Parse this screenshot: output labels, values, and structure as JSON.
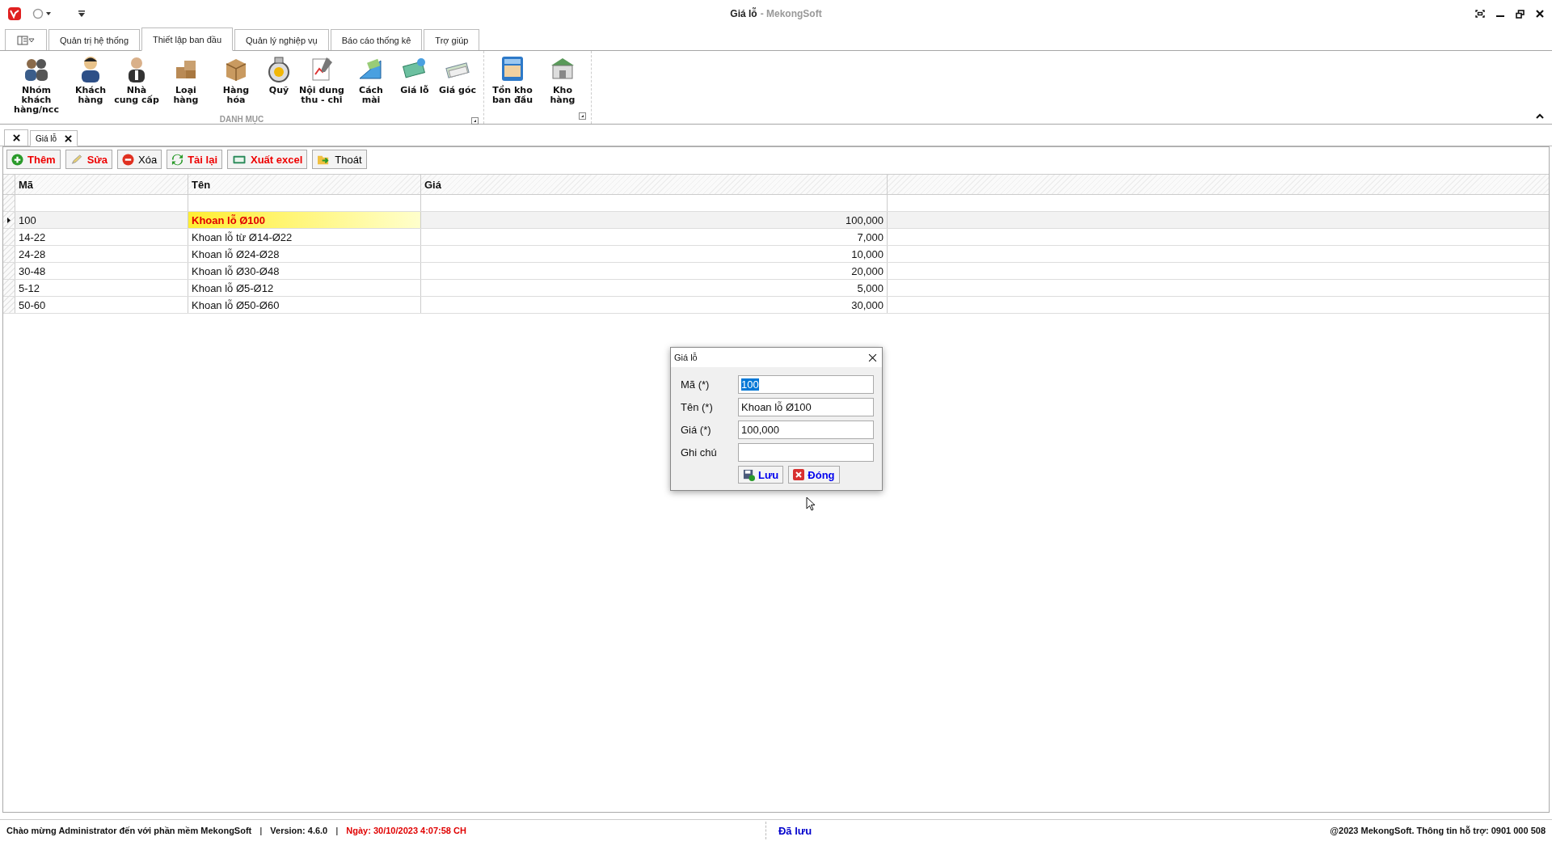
{
  "window": {
    "title": "Giá lỗ",
    "app_name": "- MekongSoft"
  },
  "ribbon_tabs": [
    {
      "label": "Quản trị hệ thống",
      "selected": false
    },
    {
      "label": "Thiết lập ban đầu",
      "selected": true
    },
    {
      "label": "Quản lý nghiệp vụ",
      "selected": false
    },
    {
      "label": "Báo cáo thống kê",
      "selected": false
    },
    {
      "label": "Trợ giúp",
      "selected": false
    }
  ],
  "ribbon_groups": [
    {
      "label": "DANH MỤC",
      "items": [
        "Nhóm khách hàng/ncc",
        "Khách hàng",
        "Nhà cung cấp",
        "Loại hàng",
        "Hàng hóa",
        "Quỹ",
        "Nội dung thu - chi",
        "Cách mài",
        "Giá lỗ",
        "Giá góc"
      ]
    },
    {
      "items": [
        "Tồn kho ban đầu",
        "Kho hàng"
      ]
    }
  ],
  "doc_tabs": [
    {
      "label": "Giá lỗ",
      "selected": true
    }
  ],
  "toolbar": [
    {
      "label": "Thêm",
      "color": "#ee0000"
    },
    {
      "label": "Sửa",
      "color": "#ee0000"
    },
    {
      "label": "Xóa",
      "color": "#000000"
    },
    {
      "label": "Tải lại",
      "color": "#ee0000"
    },
    {
      "label": "Xuất excel",
      "color": "#ee0000"
    },
    {
      "label": "Thoát",
      "color": "#000000"
    }
  ],
  "table": {
    "columns": [
      "Mã",
      "Tên",
      "Giá"
    ],
    "rows": [
      {
        "cells": [
          "100",
          "Khoan lỗ Ø100",
          "100,000"
        ],
        "selected": true
      },
      {
        "cells": [
          "14-22",
          "Khoan lỗ từ Ø14-Ø22",
          "7,000"
        ],
        "selected": false
      },
      {
        "cells": [
          "24-28",
          "Khoan lỗ Ø24-Ø28",
          "10,000"
        ],
        "selected": false
      },
      {
        "cells": [
          "30-48",
          "Khoan lỗ Ø30-Ø48",
          "20,000"
        ],
        "selected": false
      },
      {
        "cells": [
          "5-12",
          "Khoan lỗ Ø5-Ø12",
          "5,000"
        ],
        "selected": false
      },
      {
        "cells": [
          "50-60",
          "Khoan lỗ Ø50-Ø60",
          "30,000"
        ],
        "selected": false
      }
    ]
  },
  "dialog": {
    "title": "Giá lỗ",
    "fields": [
      {
        "label": "Mã (*)",
        "value": "100",
        "text_selected": true
      },
      {
        "label": "Tên (*)",
        "value": "Khoan lỗ Ø100",
        "text_selected": false
      },
      {
        "label": "Giá (*)",
        "value": "100,000",
        "text_selected": false
      },
      {
        "label": "Ghi chú"
      }
    ],
    "buttons": [
      {
        "label": "Lưu",
        "kind": "save"
      },
      {
        "label": "Đóng",
        "kind": "close"
      }
    ]
  },
  "status_bar": {
    "welcome": "Chào mừng Administrator đến với phần mềm MekongSoft",
    "separator_1": "|",
    "version": "Version: 4.6.0",
    "separator_2": "|",
    "date": "Ngày: 30/10/2023 4:07:58 CH",
    "saved": "Đã lưu",
    "copyright": "@2023 MekongSoft. Thông tin hỗ trợ: 0901 000 508"
  }
}
